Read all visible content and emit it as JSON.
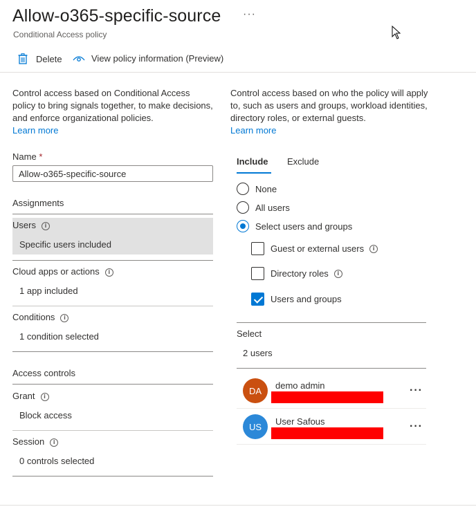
{
  "header": {
    "title": "Allow-o365-specific-source",
    "more_label": "···",
    "subtitle": "Conditional Access policy"
  },
  "toolbar": {
    "delete_label": "Delete",
    "view_policy_label": "View policy information (Preview)"
  },
  "left": {
    "description": "Control access based on Conditional Access policy to bring signals together, to make decisions, and enforce organizational policies.",
    "learn_more": "Learn more",
    "name_label": "Name",
    "name_required": "*",
    "name_value": "Allow-o365-specific-source",
    "assignments_heading": "Assignments",
    "users_label": "Users",
    "users_value": "Specific users included",
    "cloud_apps_label": "Cloud apps or actions",
    "cloud_apps_value": "1 app included",
    "conditions_label": "Conditions",
    "conditions_value": "1 condition selected",
    "access_controls_heading": "Access controls",
    "grant_label": "Grant",
    "grant_value": "Block access",
    "session_label": "Session",
    "session_value": "0 controls selected"
  },
  "right": {
    "description": "Control access based on who the policy will apply to, such as users and groups, workload identities, directory roles, or external guests.",
    "learn_more": "Learn more",
    "tabs": [
      {
        "label": "Include",
        "active": true
      },
      {
        "label": "Exclude",
        "active": false
      }
    ],
    "radios": [
      {
        "label": "None",
        "checked": false
      },
      {
        "label": "All users",
        "checked": false
      },
      {
        "label": "Select users and groups",
        "checked": true
      }
    ],
    "checkboxes": [
      {
        "label": "Guest or external users",
        "checked": false,
        "info": true
      },
      {
        "label": "Directory roles",
        "checked": false,
        "info": true
      },
      {
        "label": "Users and groups",
        "checked": true,
        "info": false
      }
    ],
    "select_label": "Select",
    "select_value": "2 users",
    "users": [
      {
        "initials": "DA",
        "name": "demo admin",
        "color": "#ca5010"
      },
      {
        "initials": "US",
        "name": "User Safous",
        "color": "#2b88d8"
      }
    ],
    "more_label": "···"
  },
  "colors": {
    "accent": "#0078d4",
    "redaction": "#ff0000",
    "selected_row": "#e1e1e1"
  },
  "icons": {
    "info": "i"
  }
}
